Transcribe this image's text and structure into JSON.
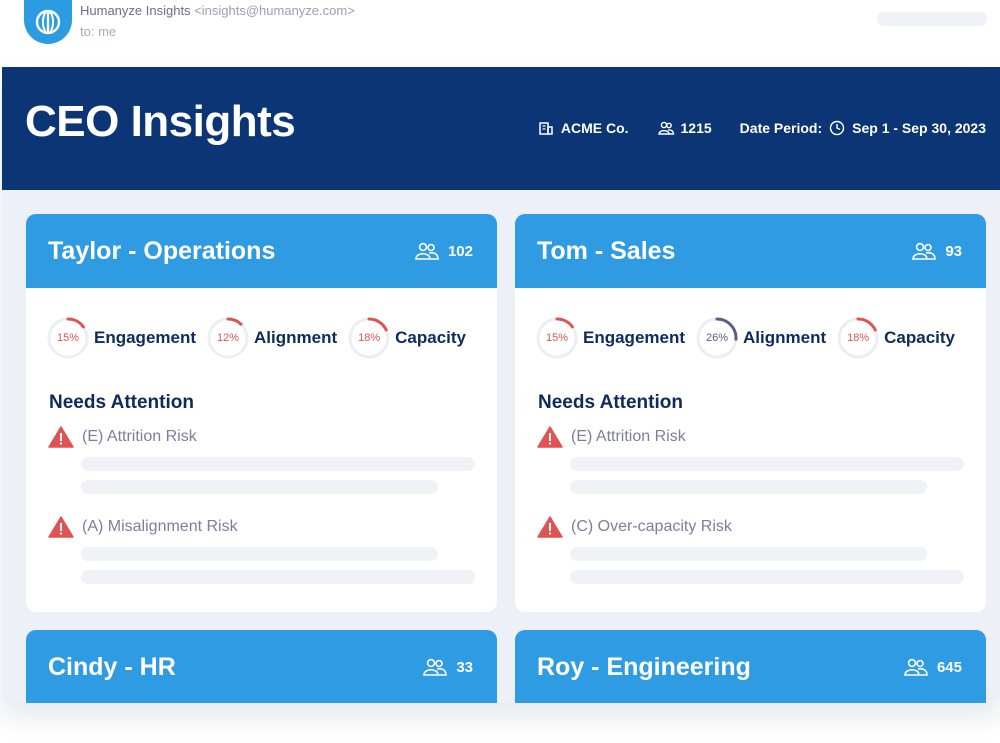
{
  "email": {
    "sender_name": "Humanyze Insights",
    "sender_address": "<insights@humanyze.com>",
    "to": "to: me"
  },
  "banner": {
    "title": "CEO Insights",
    "company": "ACME Co.",
    "headcount": "1215",
    "date_label": "Date Period:",
    "date_range": "Sep 1 - Sep 30, 2023"
  },
  "cards": [
    {
      "title": "Taylor - Operations",
      "count": "102",
      "metrics": [
        {
          "pct": "15%",
          "label": "Engagement",
          "value": 0.15,
          "status": "alert"
        },
        {
          "pct": "12%",
          "label": "Alignment",
          "value": 0.12,
          "status": "alert"
        },
        {
          "pct": "18%",
          "label": "Capacity",
          "value": 0.18,
          "status": "alert"
        }
      ],
      "needs_title": "Needs Attention",
      "risks": [
        {
          "label": "(E) Attrition Risk"
        },
        {
          "label": "(A) Misalignment Risk"
        }
      ]
    },
    {
      "title": "Tom - Sales",
      "count": "93",
      "metrics": [
        {
          "pct": "15%",
          "label": "Engagement",
          "value": 0.15,
          "status": "alert"
        },
        {
          "pct": "26%",
          "label": "Alignment",
          "value": 0.26,
          "status": "neutral"
        },
        {
          "pct": "18%",
          "label": "Capacity",
          "value": 0.18,
          "status": "alert"
        }
      ],
      "needs_title": "Needs Attention",
      "risks": [
        {
          "label": "(E) Attrition Risk"
        },
        {
          "label": "(C) Over-capacity Risk"
        }
      ]
    },
    {
      "title": "Cindy - HR",
      "count": "33"
    },
    {
      "title": "Roy - Engineering",
      "count": "645"
    }
  ],
  "colors": {
    "banner": "#0b3574",
    "card_header": "#2e9be3",
    "alert": "#e05353",
    "neutral_ring": "#5a5f86"
  },
  "icons": [
    "globe-icon",
    "building-icon",
    "people-icon",
    "clock-icon",
    "warning-icon"
  ]
}
